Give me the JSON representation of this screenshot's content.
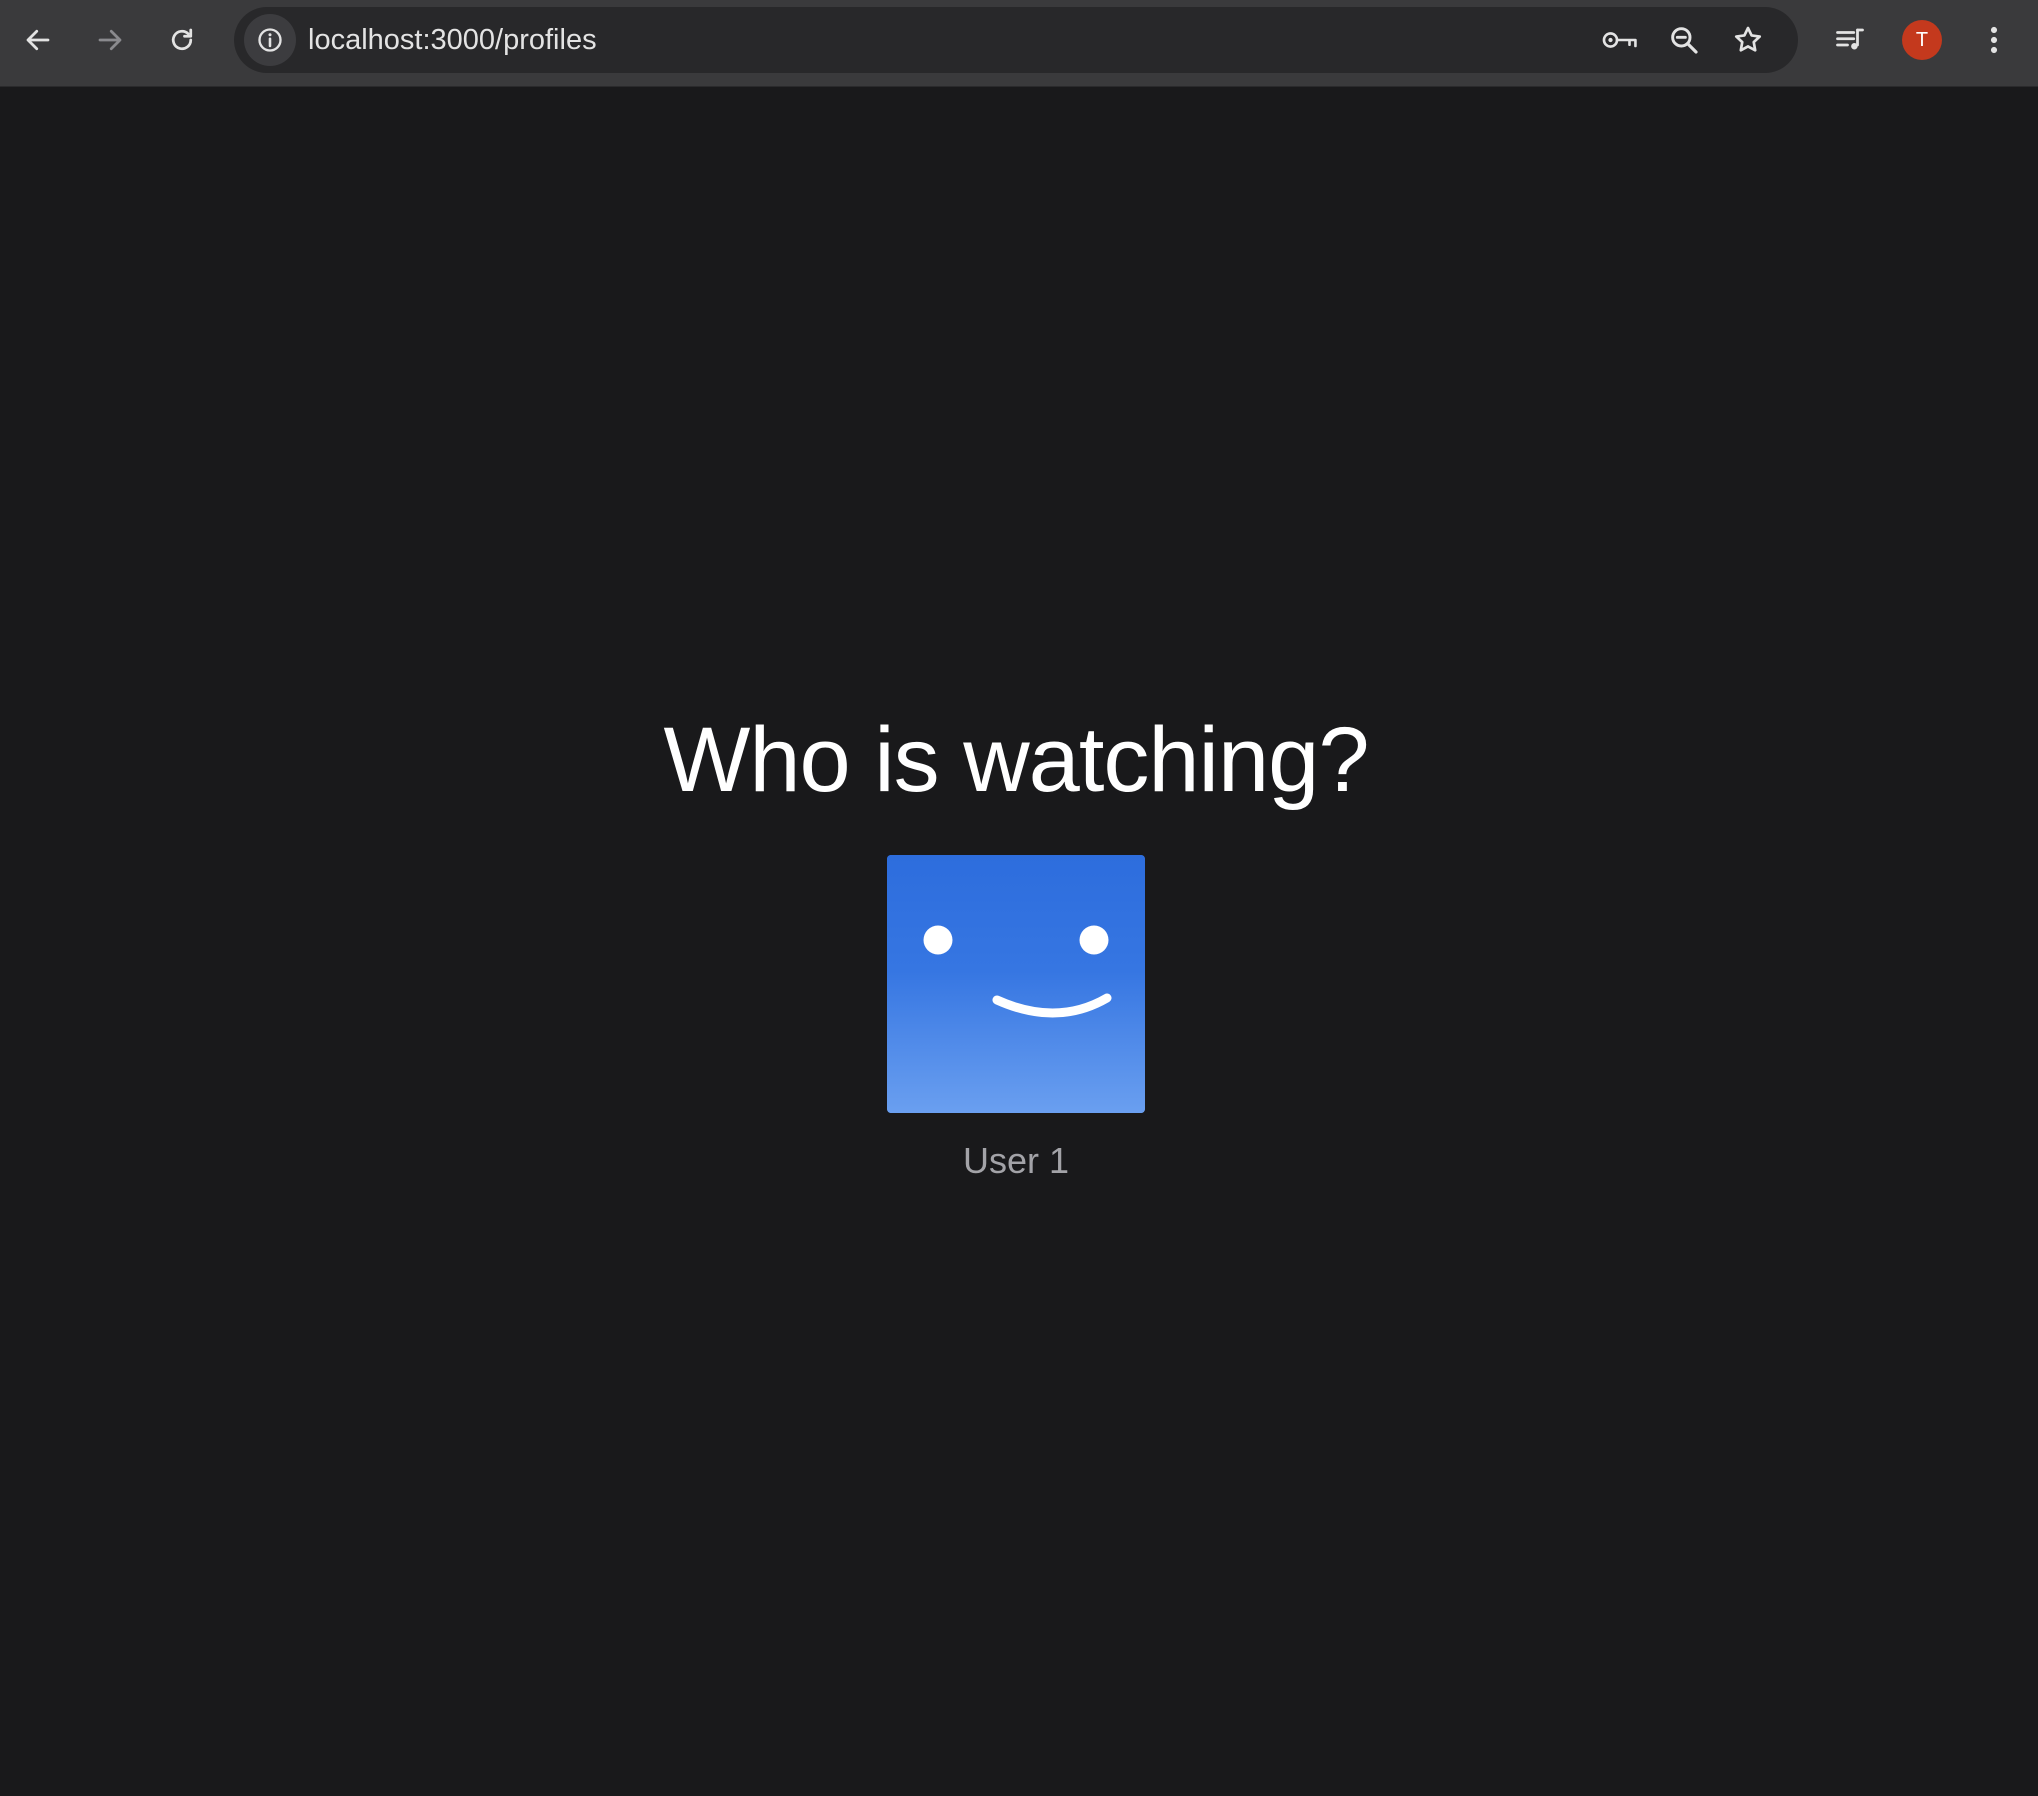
{
  "browser": {
    "url": "localhost:3000/profiles",
    "account_initial": "T",
    "colors": {
      "toolbar_bg": "#3a3a3c",
      "omnibox_bg": "#28282a",
      "avatar_bg": "#c4391d"
    },
    "icons": {
      "back": "arrow-left-icon",
      "forward": "arrow-right-icon",
      "reload": "reload-icon",
      "site_info": "info-icon",
      "passwords": "key-icon",
      "zoom": "zoom-out-icon",
      "bookmark": "star-icon",
      "media": "media-queue-icon",
      "menu": "kebab-menu-icon"
    }
  },
  "page": {
    "title": "Who is watching?",
    "background": "#19191b",
    "profiles": [
      {
        "name": "User 1",
        "avatar_icon": "smiley-face-icon",
        "avatar_color": "#2e6fde"
      }
    ]
  }
}
